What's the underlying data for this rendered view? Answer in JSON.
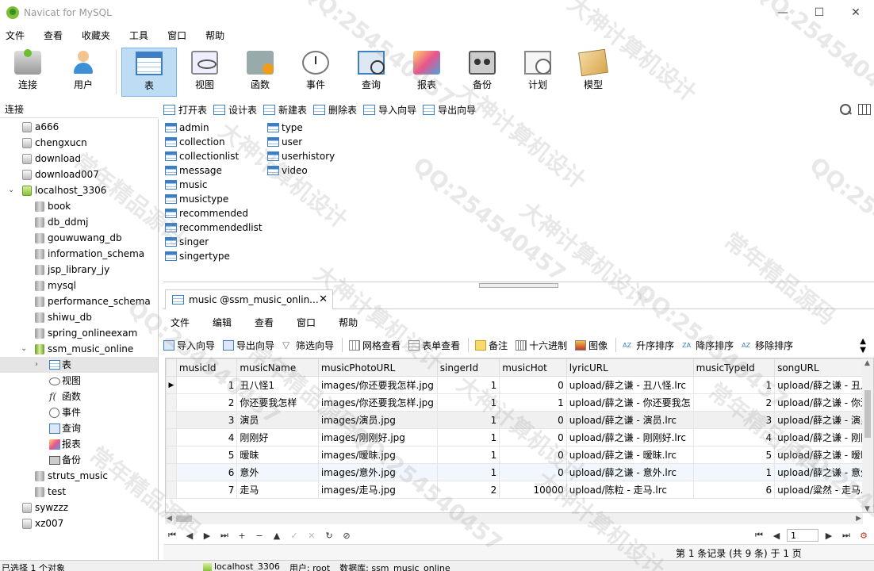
{
  "window": {
    "title": "Navicat for MySQL",
    "minimize": "—",
    "maximize": "☐",
    "close": "✕"
  },
  "menubar": [
    "文件",
    "查看",
    "收藏夹",
    "工具",
    "窗口",
    "帮助"
  ],
  "main_toolbar": [
    {
      "label": "连接",
      "icon": "connection-icon"
    },
    {
      "label": "用户",
      "icon": "user-icon"
    },
    {
      "label": "表",
      "icon": "table-icon",
      "active": true
    },
    {
      "label": "视图",
      "icon": "view-icon"
    },
    {
      "label": "函数",
      "icon": "function-icon"
    },
    {
      "label": "事件",
      "icon": "event-icon"
    },
    {
      "label": "查询",
      "icon": "query-icon"
    },
    {
      "label": "报表",
      "icon": "report-icon"
    },
    {
      "label": "备份",
      "icon": "backup-icon"
    },
    {
      "label": "计划",
      "icon": "schedule-icon"
    },
    {
      "label": "模型",
      "icon": "model-icon"
    }
  ],
  "connection_header": "连接",
  "object_toolbar": [
    "打开表",
    "设计表",
    "新建表",
    "删除表",
    "导入向导",
    "导出向导"
  ],
  "tree": [
    {
      "label": "a666",
      "type": "conn",
      "level": 0
    },
    {
      "label": "chengxucn",
      "type": "conn",
      "level": 0
    },
    {
      "label": "download",
      "type": "conn",
      "level": 0
    },
    {
      "label": "download007",
      "type": "conn",
      "level": 0
    },
    {
      "label": "localhost_3306",
      "type": "conn-open",
      "level": 0,
      "expanded": true
    },
    {
      "label": "book",
      "type": "db",
      "level": 1
    },
    {
      "label": "db_ddmj",
      "type": "db",
      "level": 1
    },
    {
      "label": "gouwuwang_db",
      "type": "db",
      "level": 1
    },
    {
      "label": "information_schema",
      "type": "db",
      "level": 1
    },
    {
      "label": "jsp_library_jy",
      "type": "db",
      "level": 1
    },
    {
      "label": "mysql",
      "type": "db",
      "level": 1
    },
    {
      "label": "performance_schema",
      "type": "db",
      "level": 1
    },
    {
      "label": "shiwu_db",
      "type": "db",
      "level": 1
    },
    {
      "label": "spring_onlineexam",
      "type": "db",
      "level": 1
    },
    {
      "label": "ssm_music_online",
      "type": "db-open",
      "level": 1,
      "expanded": true
    },
    {
      "label": "表",
      "type": "table",
      "level": 2,
      "selected": true,
      "collapsed": true
    },
    {
      "label": "视图",
      "type": "view",
      "level": 2
    },
    {
      "label": "函数",
      "type": "func",
      "level": 2
    },
    {
      "label": "事件",
      "type": "event",
      "level": 2
    },
    {
      "label": "查询",
      "type": "query",
      "level": 2
    },
    {
      "label": "报表",
      "type": "report",
      "level": 2
    },
    {
      "label": "备份",
      "type": "backup",
      "level": 2
    },
    {
      "label": "struts_music",
      "type": "db",
      "level": 1
    },
    {
      "label": "test",
      "type": "db",
      "level": 1
    },
    {
      "label": "sywzzz",
      "type": "conn",
      "level": 0
    },
    {
      "label": "xz007",
      "type": "conn",
      "level": 0
    }
  ],
  "tables_col1": [
    "admin",
    "collection",
    "collectionlist",
    "message",
    "music",
    "musictype",
    "recommended",
    "recommendedlist",
    "singer",
    "singertype"
  ],
  "tables_col2": [
    "type",
    "user",
    "userhistory",
    "video"
  ],
  "doc_tab": {
    "label": "music @ssm_music_onlin...",
    "close": "✕"
  },
  "inner_menu": [
    "文件",
    "编辑",
    "查看",
    "窗口",
    "帮助"
  ],
  "inner_toolbar": [
    "导入向导",
    "导出向导",
    "筛选向导",
    "网格查看",
    "表单查看",
    "备注",
    "十六进制",
    "图像",
    "升序排序",
    "降序排序",
    "移除排序"
  ],
  "grid": {
    "columns": [
      "musicId",
      "musicName",
      "musicPhotoURL",
      "singerId",
      "musicHot",
      "lyricURL",
      "musicTypeId",
      "songURL"
    ],
    "rows": [
      [
        "1",
        "丑八怪1",
        "images/你还要我怎样.jpg",
        "1",
        "0",
        "upload/薛之谦 - 丑八怪.lrc",
        "1",
        "upload/薛之谦 - 丑八"
      ],
      [
        "2",
        "你还要我怎样",
        "images/你还要我怎样.jpg",
        "1",
        "1",
        "upload/薛之谦 - 你还要我怎",
        "2",
        "upload/薛之谦 - 你还"
      ],
      [
        "3",
        "演员",
        "images/演员.jpg",
        "1",
        "0",
        "upload/薛之谦 - 演员.lrc",
        "3",
        "upload/薛之谦 - 演员"
      ],
      [
        "4",
        "刚刚好",
        "images/刚刚好.jpg",
        "1",
        "0",
        "upload/薛之谦 - 刚刚好.lrc",
        "4",
        "upload/薛之谦 - 刚刚"
      ],
      [
        "5",
        "暧昧",
        "images/暧昧.jpg",
        "1",
        "0",
        "upload/薛之谦 - 暧昧.lrc",
        "5",
        "upload/薛之谦 - 暧昧"
      ],
      [
        "6",
        "意外",
        "images/意外.jpg",
        "1",
        "0",
        "upload/薛之谦 - 意外.lrc",
        "1",
        "upload/薛之谦 - 意外"
      ],
      [
        "7",
        "走马",
        "images/走马.jpg",
        "2",
        "10000",
        "upload/陈粒 - 走马.lrc",
        "6",
        "upload/粱然 - 走马."
      ]
    ]
  },
  "nav": {
    "first": "⏮",
    "prev": "◀",
    "next": "▶",
    "last": "⏭",
    "add": "+",
    "remove": "−",
    "up": "▲",
    "apply": "✓",
    "cancel": "✕",
    "refresh": "↻",
    "stop": "⊘",
    "page_value": "1"
  },
  "record_status": "第 1 条记录 (共 9 条) 于 1 页",
  "statusbar": {
    "left": "已选择 1 个对象",
    "connection": "localhost_3306",
    "user": "用户: root",
    "database": "数据库: ssm_music_online"
  },
  "watermark": [
    "大神计算机设计",
    "QQ:254540457",
    "常年精品源码"
  ]
}
